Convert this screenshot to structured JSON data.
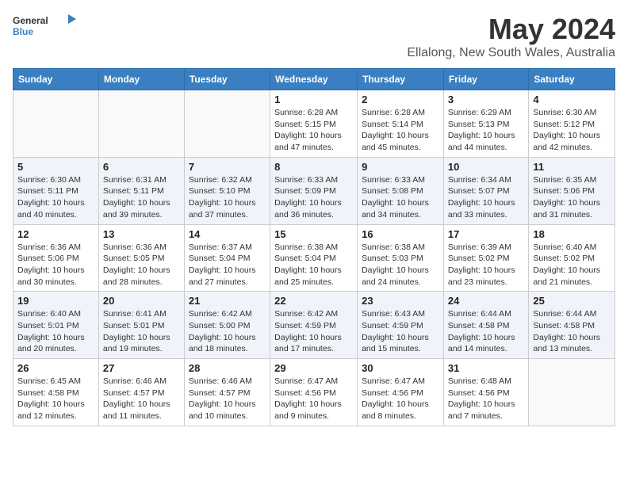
{
  "header": {
    "logo_general": "General",
    "logo_blue": "Blue",
    "title": "May 2024",
    "subtitle": "Ellalong, New South Wales, Australia"
  },
  "columns": [
    "Sunday",
    "Monday",
    "Tuesday",
    "Wednesday",
    "Thursday",
    "Friday",
    "Saturday"
  ],
  "weeks": [
    [
      {
        "day": "",
        "info": ""
      },
      {
        "day": "",
        "info": ""
      },
      {
        "day": "",
        "info": ""
      },
      {
        "day": "1",
        "info": "Sunrise: 6:28 AM\nSunset: 5:15 PM\nDaylight: 10 hours\nand 47 minutes."
      },
      {
        "day": "2",
        "info": "Sunrise: 6:28 AM\nSunset: 5:14 PM\nDaylight: 10 hours\nand 45 minutes."
      },
      {
        "day": "3",
        "info": "Sunrise: 6:29 AM\nSunset: 5:13 PM\nDaylight: 10 hours\nand 44 minutes."
      },
      {
        "day": "4",
        "info": "Sunrise: 6:30 AM\nSunset: 5:12 PM\nDaylight: 10 hours\nand 42 minutes."
      }
    ],
    [
      {
        "day": "5",
        "info": "Sunrise: 6:30 AM\nSunset: 5:11 PM\nDaylight: 10 hours\nand 40 minutes."
      },
      {
        "day": "6",
        "info": "Sunrise: 6:31 AM\nSunset: 5:11 PM\nDaylight: 10 hours\nand 39 minutes."
      },
      {
        "day": "7",
        "info": "Sunrise: 6:32 AM\nSunset: 5:10 PM\nDaylight: 10 hours\nand 37 minutes."
      },
      {
        "day": "8",
        "info": "Sunrise: 6:33 AM\nSunset: 5:09 PM\nDaylight: 10 hours\nand 36 minutes."
      },
      {
        "day": "9",
        "info": "Sunrise: 6:33 AM\nSunset: 5:08 PM\nDaylight: 10 hours\nand 34 minutes."
      },
      {
        "day": "10",
        "info": "Sunrise: 6:34 AM\nSunset: 5:07 PM\nDaylight: 10 hours\nand 33 minutes."
      },
      {
        "day": "11",
        "info": "Sunrise: 6:35 AM\nSunset: 5:06 PM\nDaylight: 10 hours\nand 31 minutes."
      }
    ],
    [
      {
        "day": "12",
        "info": "Sunrise: 6:36 AM\nSunset: 5:06 PM\nDaylight: 10 hours\nand 30 minutes."
      },
      {
        "day": "13",
        "info": "Sunrise: 6:36 AM\nSunset: 5:05 PM\nDaylight: 10 hours\nand 28 minutes."
      },
      {
        "day": "14",
        "info": "Sunrise: 6:37 AM\nSunset: 5:04 PM\nDaylight: 10 hours\nand 27 minutes."
      },
      {
        "day": "15",
        "info": "Sunrise: 6:38 AM\nSunset: 5:04 PM\nDaylight: 10 hours\nand 25 minutes."
      },
      {
        "day": "16",
        "info": "Sunrise: 6:38 AM\nSunset: 5:03 PM\nDaylight: 10 hours\nand 24 minutes."
      },
      {
        "day": "17",
        "info": "Sunrise: 6:39 AM\nSunset: 5:02 PM\nDaylight: 10 hours\nand 23 minutes."
      },
      {
        "day": "18",
        "info": "Sunrise: 6:40 AM\nSunset: 5:02 PM\nDaylight: 10 hours\nand 21 minutes."
      }
    ],
    [
      {
        "day": "19",
        "info": "Sunrise: 6:40 AM\nSunset: 5:01 PM\nDaylight: 10 hours\nand 20 minutes."
      },
      {
        "day": "20",
        "info": "Sunrise: 6:41 AM\nSunset: 5:01 PM\nDaylight: 10 hours\nand 19 minutes."
      },
      {
        "day": "21",
        "info": "Sunrise: 6:42 AM\nSunset: 5:00 PM\nDaylight: 10 hours\nand 18 minutes."
      },
      {
        "day": "22",
        "info": "Sunrise: 6:42 AM\nSunset: 4:59 PM\nDaylight: 10 hours\nand 17 minutes."
      },
      {
        "day": "23",
        "info": "Sunrise: 6:43 AM\nSunset: 4:59 PM\nDaylight: 10 hours\nand 15 minutes."
      },
      {
        "day": "24",
        "info": "Sunrise: 6:44 AM\nSunset: 4:58 PM\nDaylight: 10 hours\nand 14 minutes."
      },
      {
        "day": "25",
        "info": "Sunrise: 6:44 AM\nSunset: 4:58 PM\nDaylight: 10 hours\nand 13 minutes."
      }
    ],
    [
      {
        "day": "26",
        "info": "Sunrise: 6:45 AM\nSunset: 4:58 PM\nDaylight: 10 hours\nand 12 minutes."
      },
      {
        "day": "27",
        "info": "Sunrise: 6:46 AM\nSunset: 4:57 PM\nDaylight: 10 hours\nand 11 minutes."
      },
      {
        "day": "28",
        "info": "Sunrise: 6:46 AM\nSunset: 4:57 PM\nDaylight: 10 hours\nand 10 minutes."
      },
      {
        "day": "29",
        "info": "Sunrise: 6:47 AM\nSunset: 4:56 PM\nDaylight: 10 hours\nand 9 minutes."
      },
      {
        "day": "30",
        "info": "Sunrise: 6:47 AM\nSunset: 4:56 PM\nDaylight: 10 hours\nand 8 minutes."
      },
      {
        "day": "31",
        "info": "Sunrise: 6:48 AM\nSunset: 4:56 PM\nDaylight: 10 hours\nand 7 minutes."
      },
      {
        "day": "",
        "info": ""
      }
    ]
  ]
}
